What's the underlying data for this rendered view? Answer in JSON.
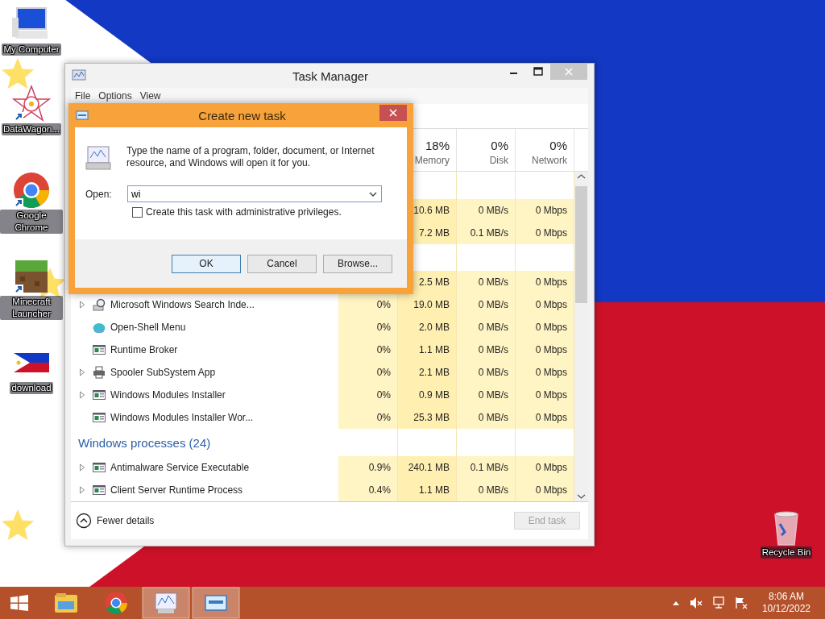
{
  "desktop_icons": [
    {
      "label": "My Computer",
      "kind": "computer",
      "shortcut": false
    },
    {
      "label": "DataWagon...",
      "kind": "mandala",
      "shortcut": true
    },
    {
      "label": "Google Chrome",
      "kind": "chrome",
      "shortcut": true
    },
    {
      "label": "Minecraft Launcher",
      "kind": "grass-block",
      "shortcut": true
    },
    {
      "label": "download",
      "kind": "flag",
      "shortcut": false
    }
  ],
  "recycle_bin": {
    "label": "Recycle Bin"
  },
  "task_manager": {
    "title": "Task Manager",
    "menu": [
      "File",
      "Options",
      "View"
    ],
    "columns": [
      {
        "percent": "18%",
        "label": "Memory"
      },
      {
        "percent": "0%",
        "label": "Disk"
      },
      {
        "percent": "0%",
        "label": "Network"
      }
    ],
    "rows": [
      {
        "kind": "group"
      },
      {
        "kind": "process",
        "memory": "10.6 MB",
        "disk": "0 MB/s",
        "network": "0 Mbps"
      },
      {
        "kind": "process",
        "memory": "7.2 MB",
        "disk": "0.1 MB/s",
        "network": "0 Mbps"
      },
      {
        "kind": "group"
      },
      {
        "kind": "process",
        "memory": "2.5 MB",
        "disk": "0 MB/s",
        "network": "0 Mbps"
      },
      {
        "kind": "search",
        "name": "Microsoft Windows Search Inde...",
        "expandable": true,
        "cpu": "0%",
        "memory": "19.0 MB",
        "disk": "0 MB/s",
        "network": "0 Mbps"
      },
      {
        "kind": "shell",
        "name": "Open-Shell Menu",
        "expandable": false,
        "cpu": "0%",
        "memory": "2.0 MB",
        "disk": "0 MB/s",
        "network": "0 Mbps"
      },
      {
        "kind": "app",
        "name": "Runtime Broker",
        "expandable": false,
        "cpu": "0%",
        "memory": "1.1 MB",
        "disk": "0 MB/s",
        "network": "0 Mbps"
      },
      {
        "kind": "printer",
        "name": "Spooler SubSystem App",
        "expandable": true,
        "cpu": "0%",
        "memory": "2.1 MB",
        "disk": "0 MB/s",
        "network": "0 Mbps"
      },
      {
        "kind": "app",
        "name": "Windows Modules Installer",
        "expandable": true,
        "cpu": "0%",
        "memory": "0.9 MB",
        "disk": "0 MB/s",
        "network": "0 Mbps"
      },
      {
        "kind": "app",
        "name": "Windows Modules Installer Wor...",
        "expandable": false,
        "cpu": "0%",
        "memory": "25.3 MB",
        "disk": "0 MB/s",
        "network": "0 Mbps"
      },
      {
        "kind": "group",
        "label": "Windows processes (24)"
      },
      {
        "kind": "app",
        "name": "Antimalware Service Executable",
        "expandable": true,
        "cpu": "0.9%",
        "memory": "240.1 MB",
        "disk": "0.1 MB/s",
        "network": "0 Mbps"
      },
      {
        "kind": "app",
        "name": "Client Server Runtime Process",
        "expandable": true,
        "cpu": "0.4%",
        "memory": "1.1 MB",
        "disk": "0 MB/s",
        "network": "0 Mbps"
      }
    ],
    "details_link": "Fewer details",
    "end_task": {
      "label": "End task",
      "disabled": true
    }
  },
  "dialog": {
    "title": "Create new task",
    "message": "Type the name of a program, folder, document, or Internet resource, and Windows will open it for you.",
    "open_label": "Open:",
    "open_value": "wi",
    "admin_checkbox": {
      "label": "Create this task with administrative privileges.",
      "checked": false
    },
    "buttons": [
      {
        "label": "OK",
        "default": true
      },
      {
        "label": "Cancel",
        "default": false
      },
      {
        "label": "Browse...",
        "default": false
      }
    ]
  },
  "taskbar": {
    "apps": [
      {
        "kind": "explorer",
        "active": false
      },
      {
        "kind": "chrome",
        "active": false
      },
      {
        "kind": "taskmgr",
        "active": true
      },
      {
        "kind": "run",
        "active": true
      }
    ],
    "clock": {
      "time": "8:06 AM",
      "date": "10/12/2022"
    }
  }
}
